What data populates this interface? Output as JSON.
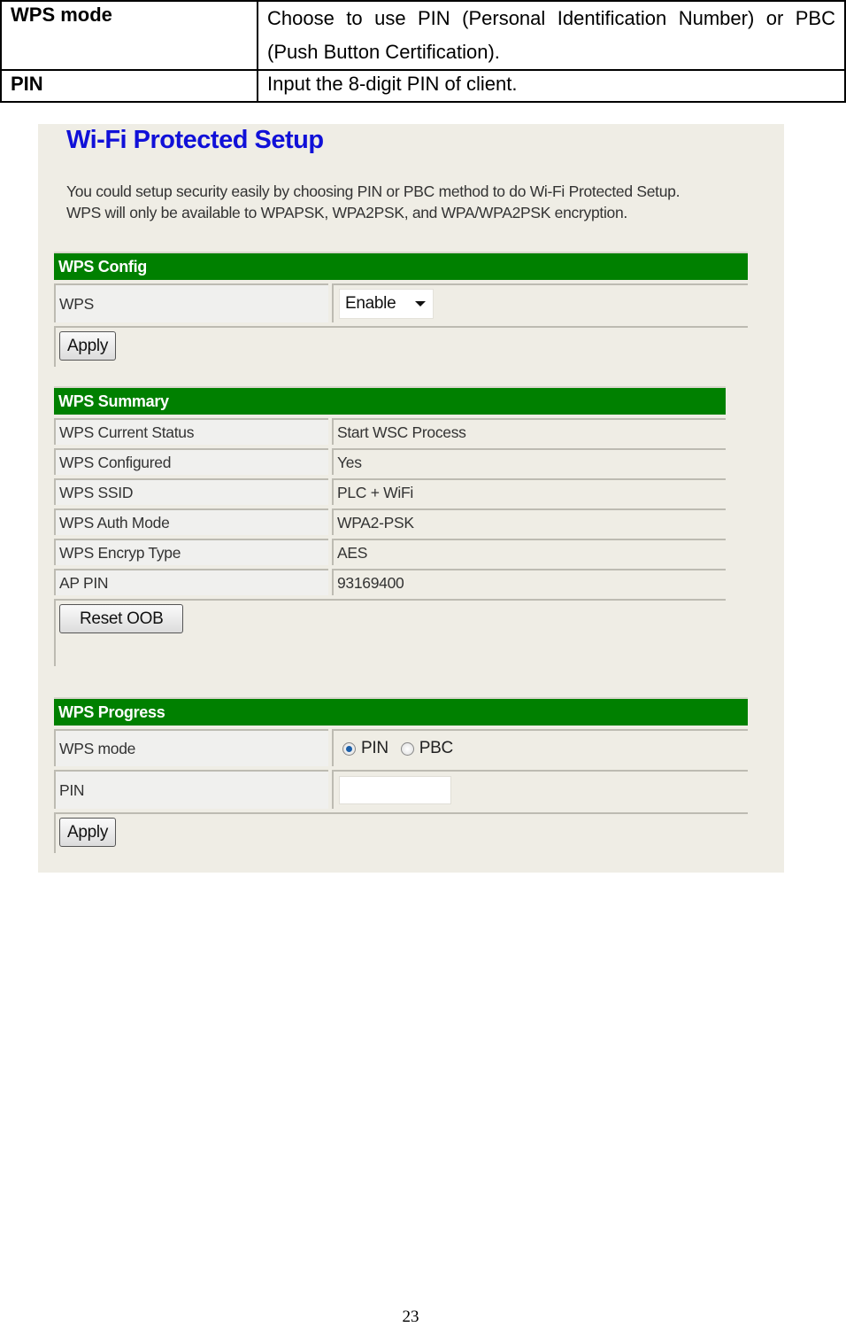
{
  "description_table": {
    "rows": [
      {
        "term": "WPS mode",
        "definition": "Choose to use PIN (Personal Identification Number) or PBC (Push Button Certification)."
      },
      {
        "term": "PIN",
        "definition": "Input the 8-digit PIN of client."
      }
    ]
  },
  "screenshot": {
    "title": "Wi-Fi Protected Setup",
    "intro_line1": "You could setup security easily by choosing PIN or PBC method to do Wi-Fi Protected Setup.",
    "intro_line2": "WPS will only be available to WPAPSK, WPA2PSK, and WPA/WPA2PSK encryption.",
    "header_color": "#008000",
    "title_color": "#1010d8",
    "wps_config": {
      "header": "WPS Config",
      "wps_label": "WPS",
      "wps_select_value": "Enable",
      "apply_label": "Apply"
    },
    "wps_summary": {
      "header": "WPS Summary",
      "rows": [
        {
          "label": "WPS Current Status",
          "value": "Start WSC Process"
        },
        {
          "label": "WPS Configured",
          "value": "Yes"
        },
        {
          "label": "WPS SSID",
          "value": "PLC + WiFi"
        },
        {
          "label": "WPS Auth Mode",
          "value": "WPA2-PSK"
        },
        {
          "label": "WPS Encryp Type",
          "value": "AES"
        },
        {
          "label": "AP PIN",
          "value": "93169400"
        }
      ],
      "reset_label": "Reset OOB"
    },
    "wps_progress": {
      "header": "WPS Progress",
      "mode_label": "WPS mode",
      "mode_options": [
        {
          "label": "PIN",
          "selected": true
        },
        {
          "label": "PBC",
          "selected": false
        }
      ],
      "pin_label": "PIN",
      "pin_value": "",
      "apply_label": "Apply"
    }
  },
  "page_number": "23"
}
